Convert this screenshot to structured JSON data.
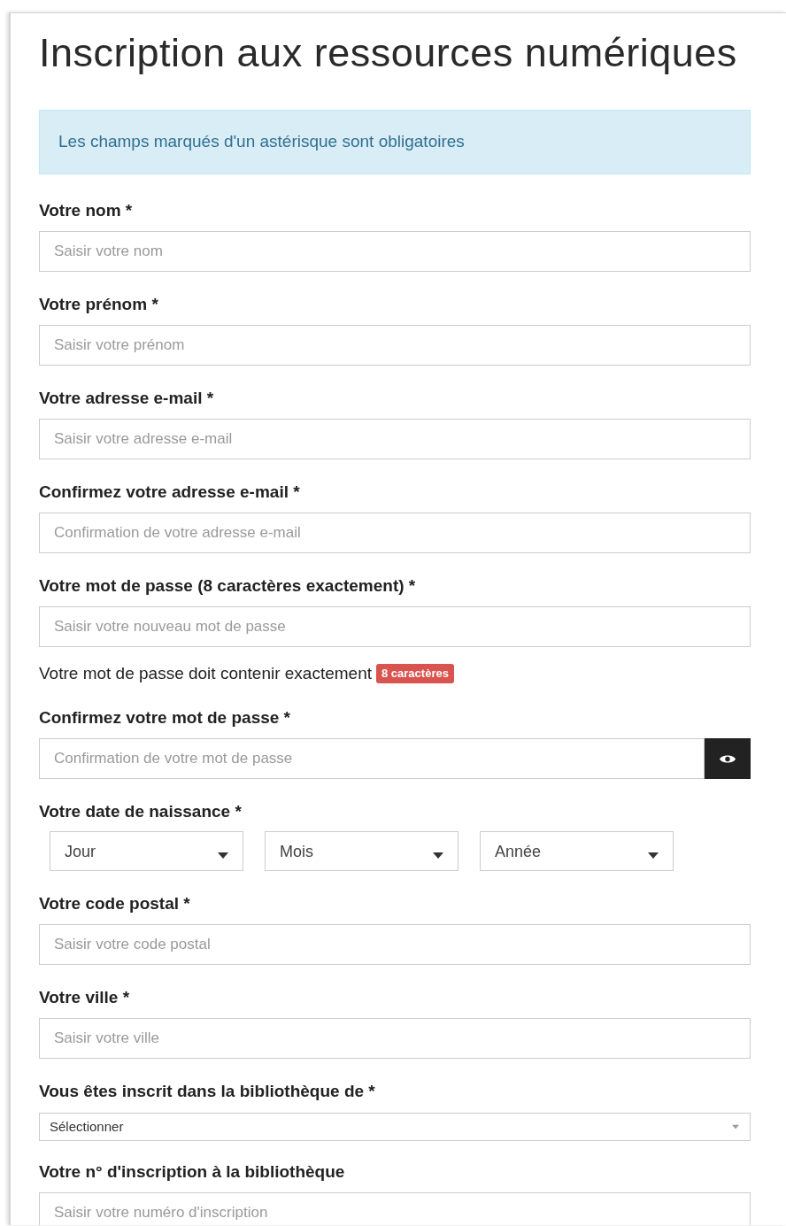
{
  "title": "Inscription aux ressources numériques",
  "alert": "Les champs marqués d'un astérisque sont obligatoires",
  "fields": [
    {
      "kind": "text",
      "label": "Votre nom *",
      "placeholder": "Saisir votre nom"
    },
    {
      "kind": "text",
      "label": "Votre prénom *",
      "placeholder": "Saisir votre prénom"
    },
    {
      "kind": "text",
      "label": "Votre adresse e-mail *",
      "placeholder": "Saisir votre adresse e-mail"
    },
    {
      "kind": "text",
      "label": "Confirmez votre adresse e-mail *",
      "placeholder": "Confirmation de votre adresse e-mail"
    },
    {
      "kind": "text",
      "label": "Votre mot de passe (8 caractères exactement) *",
      "placeholder": "Saisir votre nouveau mot de passe"
    },
    {
      "kind": "hint",
      "text": "Votre mot de passe doit contenir exactement",
      "badge": "8 caractères"
    },
    {
      "kind": "reveal",
      "label": "Confirmez votre mot de passe *",
      "placeholder": "Confirmation de votre mot de passe"
    },
    {
      "kind": "date",
      "label": "Votre date de naissance *",
      "selects": [
        "Jour",
        "Mois",
        "Année"
      ]
    },
    {
      "kind": "text",
      "label": "Votre code postal *",
      "placeholder": "Saisir votre code postal"
    },
    {
      "kind": "text",
      "label": "Votre ville *",
      "placeholder": "Saisir votre ville"
    },
    {
      "kind": "select",
      "label": "Vous êtes inscrit dans la bibliothèque de *",
      "value": "Sélectionner"
    },
    {
      "kind": "text",
      "label": "Votre n° d'inscription à la bibliothèque",
      "placeholder": "Saisir votre numéro d'inscription"
    }
  ]
}
